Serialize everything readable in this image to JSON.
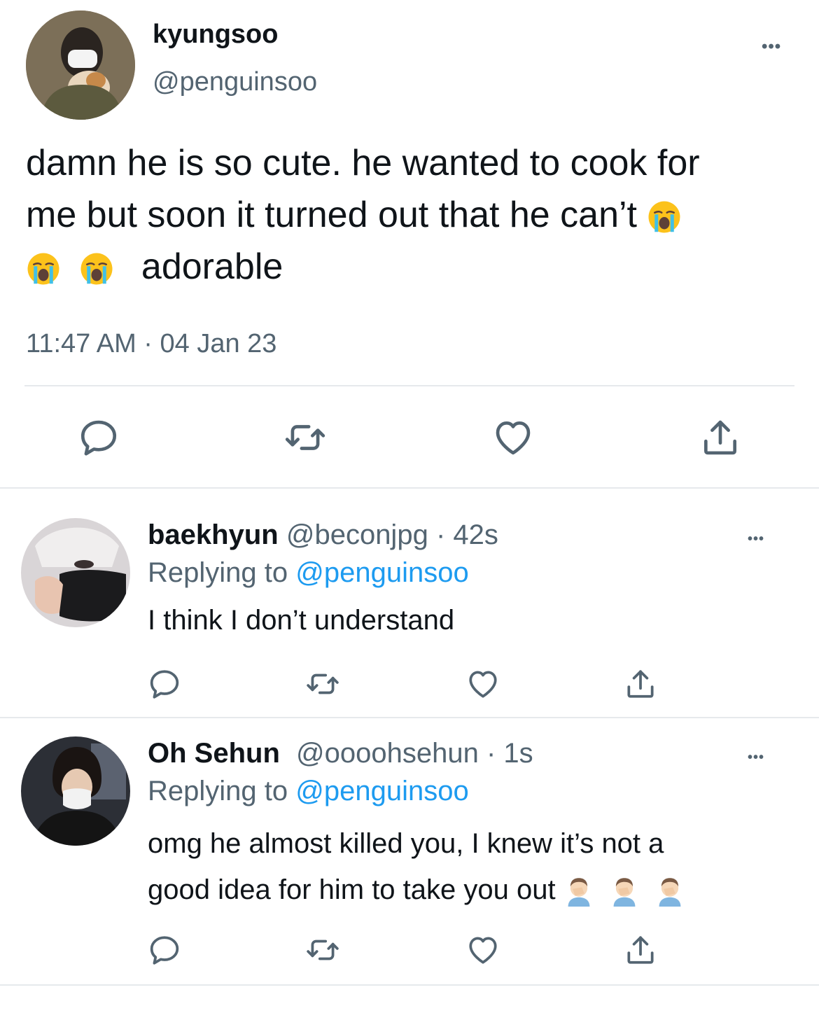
{
  "main_tweet": {
    "display_name": "kyungsoo",
    "handle": "@penguinsoo",
    "text_line1": "damn he is so cute. he wanted to cook for",
    "text_line2": "me but soon it turned out that he can’t",
    "text_line3": "adorable",
    "timestamp": "11:47 AM · 04 Jan 23",
    "more_label": "•••"
  },
  "replies": [
    {
      "display_name": "baekhyun",
      "handle": "@beconjpg",
      "age": "· 42s",
      "replying_prefix": "Replying to",
      "replying_handle": "@penguinsoo",
      "text": "I think I don’t understand",
      "more_label": "•••"
    },
    {
      "display_name": "Oh Sehun",
      "handle": "@oooohsehun",
      "age": "· 1s",
      "replying_prefix": "Replying to",
      "replying_handle": "@penguinsoo",
      "text_line1": "omg he almost killed you, I knew it’s not a",
      "text_line2": "good idea for him to take you out",
      "more_label": "•••"
    }
  ],
  "icons": [
    "reply-icon",
    "retweet-icon",
    "like-icon",
    "share-icon",
    "crying-face-emoji",
    "facepalm-emoji"
  ],
  "colors": {
    "text": "#0f1419",
    "muted": "#536471",
    "link": "#1d9bf0",
    "divider": "#e6e9ec"
  }
}
